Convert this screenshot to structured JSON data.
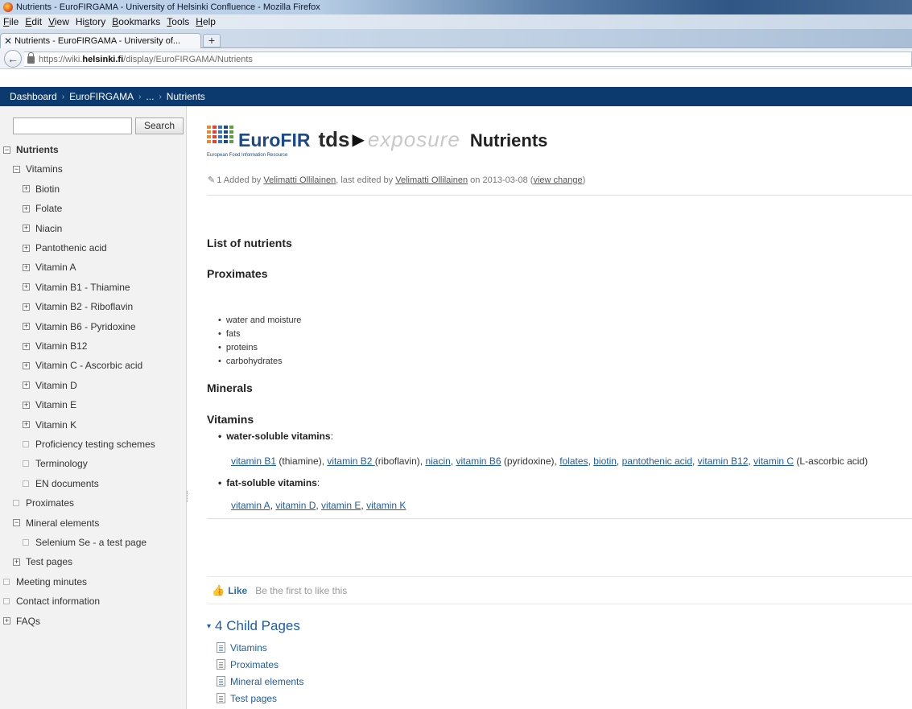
{
  "window": {
    "title": "Nutrients - EuroFIRGAMA - University of Helsinki Confluence - Mozilla Firefox",
    "brand_color": "#0d3a6e"
  },
  "menubar": {
    "items": [
      "File",
      "Edit",
      "View",
      "History",
      "Bookmarks",
      "Tools",
      "Help"
    ],
    "accesskeys": [
      "F",
      "E",
      "V",
      "s",
      "B",
      "T",
      "H"
    ]
  },
  "tab": {
    "label": "Nutrients - EuroFIRGAMA - University of...",
    "new_tab_label": "+"
  },
  "url": {
    "prefix": "https://wiki.",
    "host": "helsinki.fi",
    "path": "/display/EuroFIRGAMA/Nutrients"
  },
  "breadcrumb": {
    "items": [
      "Dashboard",
      "EuroFIRGAMA",
      "...",
      "Nutrients"
    ],
    "separator": "›"
  },
  "sidebar": {
    "search_placeholder": "",
    "search_button": "Search",
    "tree": [
      {
        "label": "Nutrients",
        "toggle": "minus",
        "bold": true
      },
      {
        "label": "Vitamins",
        "toggle": "minus"
      },
      {
        "label": "Biotin",
        "toggle": "plus"
      },
      {
        "label": "Folate",
        "toggle": "plus"
      },
      {
        "label": "Niacin",
        "toggle": "plus"
      },
      {
        "label": "Pantothenic acid",
        "toggle": "plus"
      },
      {
        "label": "Vitamin A",
        "toggle": "plus"
      },
      {
        "label": "Vitamin B1 - Thiamine",
        "toggle": "plus"
      },
      {
        "label": "Vitamin B2 - Riboflavin",
        "toggle": "plus"
      },
      {
        "label": "Vitamin B6 - Pyridoxine",
        "toggle": "plus"
      },
      {
        "label": "Vitamin B12",
        "toggle": "plus"
      },
      {
        "label": "Vitamin C - Ascorbic acid",
        "toggle": "plus"
      },
      {
        "label": "Vitamin D",
        "toggle": "plus"
      },
      {
        "label": "Vitamin E",
        "toggle": "plus"
      },
      {
        "label": "Vitamin K",
        "toggle": "plus"
      },
      {
        "label": "Proficiency testing schemes",
        "toggle": "leaf"
      },
      {
        "label": "Terminology",
        "toggle": "leaf"
      },
      {
        "label": "EN documents",
        "toggle": "leaf"
      },
      {
        "label": "Proximates",
        "toggle": "leaf"
      },
      {
        "label": "Mineral elements",
        "toggle": "minus"
      },
      {
        "label": "Selenium Se - a test page",
        "toggle": "leaf"
      },
      {
        "label": "Test pages",
        "toggle": "plus"
      },
      {
        "label": "Meeting minutes",
        "toggle": "leaf"
      },
      {
        "label": "Contact information",
        "toggle": "leaf"
      },
      {
        "label": "FAQs",
        "toggle": "plus"
      }
    ]
  },
  "logo": {
    "eurofir": "EuroFIR",
    "eurofir_sub": "European Food Information Resource",
    "tds": "tds",
    "arrow": "▶",
    "exposure": "exposure",
    "bar_colors": [
      "#f08a1e",
      "#e6403a",
      "#2d7ac0",
      "#1d4a86",
      "#5aa33a"
    ]
  },
  "page": {
    "title": "Nutrients",
    "meta": {
      "version": "1",
      "added_by_prefix": "Added by",
      "author": "Velimatti Ollilainen",
      "edited_prefix": ", last edited by",
      "editor": "Velimatti Ollilainen",
      "date_prefix": "on",
      "date": "2013-03-08",
      "view_change": "view change"
    },
    "headings": {
      "list": "List of nutrients",
      "proximates": "Proximates",
      "minerals": "Minerals",
      "vitamins": "Vitamins"
    },
    "proximates_items": [
      "water and moisture",
      "fats",
      "proteins",
      "carbohydrates"
    ],
    "water_soluble_label": "water-soluble vitamins",
    "water_soluble_links": [
      {
        "link": "vitamin B1",
        "after": " (thiamine), "
      },
      {
        "link": "vitamin B2 ",
        "after": "(riboflavin), "
      },
      {
        "link": "niacin",
        "after": ", "
      },
      {
        "link": "vitamin B6",
        "after": " (pyridoxine), "
      },
      {
        "link": "folates",
        "after": ", "
      },
      {
        "link": "biotin",
        "after": ", "
      },
      {
        "link": "pantothenic acid",
        "after": ", "
      },
      {
        "link": "vitamin B12",
        "after": ", "
      },
      {
        "link": "vitamin C",
        "after": " (L-ascorbic acid)"
      }
    ],
    "fat_soluble_label": "fat-soluble vitamins",
    "fat_soluble_links": [
      {
        "link": "vitamin A",
        "after": ", "
      },
      {
        "link": "vitamin D",
        "after": ", "
      },
      {
        "link": "vitamin E",
        "after": ", "
      },
      {
        "link": "vitamin K",
        "after": ""
      }
    ],
    "like_button": "Like",
    "like_text": "Be the first to like this",
    "child_pages_title": "4 Child Pages",
    "child_pages": [
      "Vitamins",
      "Proximates",
      "Mineral elements",
      "Test pages"
    ]
  }
}
